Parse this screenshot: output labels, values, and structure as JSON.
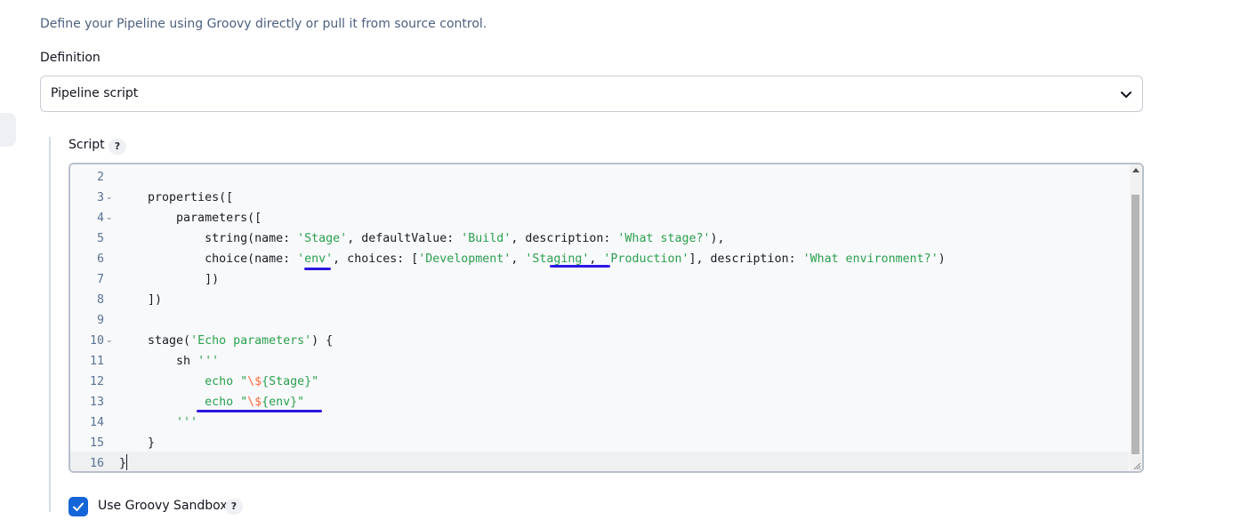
{
  "description": "Define your Pipeline using Groovy directly or pull it from source control.",
  "definition": {
    "label": "Definition",
    "selected": "Pipeline script"
  },
  "script": {
    "label": "Script",
    "help": "?",
    "line_numbers": [
      "2",
      "3",
      "4",
      "5",
      "6",
      "7",
      "8",
      "9",
      "10",
      "11",
      "12",
      "13",
      "14",
      "15",
      "16"
    ],
    "lines": [
      "",
      "    properties([",
      "        parameters([",
      "            string(name: 'Stage', defaultValue: 'Build', description: 'What stage?'),",
      "            choice(name: 'env', choices: ['Development', 'Staging', 'Production'], description: 'What environment?')",
      "            ])",
      "    ])",
      "",
      "    stage('Echo parameters') {",
      "        sh '''",
      "            echo \"\\${Stage}\"",
      "            echo \"\\${env}\"",
      "        '''",
      "    }",
      "}"
    ]
  },
  "sandbox": {
    "label": "Use Groovy Sandbox",
    "help": "?",
    "checked": true
  },
  "colors": {
    "string": "#2ba04f",
    "escape": "#ff6a3d",
    "annotation": "#2d15e6",
    "checkbox": "#1565d8"
  }
}
